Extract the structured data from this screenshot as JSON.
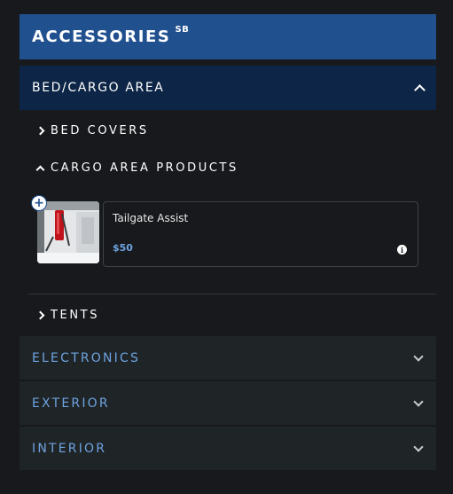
{
  "header": {
    "title": "ACCESSORIES",
    "superscript": "SB"
  },
  "open_section": {
    "label": "BED/CARGO AREA",
    "subsections": [
      {
        "label": "BED COVERS",
        "expanded": false
      },
      {
        "label": "CARGO AREA PRODUCTS",
        "expanded": true
      },
      {
        "label": "TENTS",
        "expanded": false
      }
    ],
    "product": {
      "name": "Tailgate Assist",
      "price": "$50",
      "add_symbol": "+",
      "info_symbol": "i"
    }
  },
  "closed_sections": [
    {
      "label": "ELECTRONICS"
    },
    {
      "label": "EXTERIOR"
    },
    {
      "label": "INTERIOR"
    }
  ],
  "colors": {
    "header_bg": "#21508f",
    "open_section_bg": "#0d2546",
    "closed_section_bg": "#1f2427",
    "accent_text": "#6da3e0",
    "page_bg": "#17191c"
  }
}
